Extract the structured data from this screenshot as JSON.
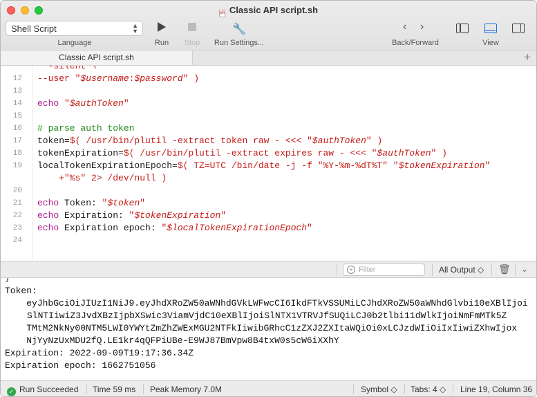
{
  "window": {
    "title": "Classic API script.sh"
  },
  "toolbar": {
    "language_value": "Shell Script",
    "language_label": "Language",
    "run_label": "Run",
    "stop_label": "Stop",
    "run_settings_label": "Run Settings...",
    "back_forward_label": "Back/Forward",
    "view_label": "View",
    "back_glyph": "‹",
    "forward_glyph": "›"
  },
  "tabs": [
    {
      "label": "Classic API script.sh"
    }
  ],
  "tab_add_glyph": "+",
  "editor": {
    "lines": [
      {
        "n": "",
        "parts": [
          {
            "c": "str",
            "t": "  -silent \\"
          }
        ]
      },
      {
        "n": "12",
        "parts": [
          {
            "c": "str",
            "t": "--user \""
          },
          {
            "c": "var",
            "t": "$username"
          },
          {
            "c": "str",
            "t": ":"
          },
          {
            "c": "var",
            "t": "$password"
          },
          {
            "c": "str",
            "t": "\" )"
          }
        ]
      },
      {
        "n": "13",
        "parts": []
      },
      {
        "n": "14",
        "parts": [
          {
            "c": "kw",
            "t": "echo "
          },
          {
            "c": "str",
            "t": "\""
          },
          {
            "c": "var",
            "t": "$authToken"
          },
          {
            "c": "str",
            "t": "\""
          }
        ]
      },
      {
        "n": "15",
        "parts": []
      },
      {
        "n": "16",
        "parts": [
          {
            "c": "cmt",
            "t": "# parse auth token"
          }
        ]
      },
      {
        "n": "17",
        "parts": [
          {
            "c": "plain",
            "t": "token="
          },
          {
            "c": "str",
            "t": "$( /usr/bin/plutil -extract token raw - <<< \""
          },
          {
            "c": "var",
            "t": "$authToken"
          },
          {
            "c": "str",
            "t": "\" )"
          }
        ]
      },
      {
        "n": "18",
        "parts": [
          {
            "c": "plain",
            "t": "tokenExpiration="
          },
          {
            "c": "str",
            "t": "$( /usr/bin/plutil -extract expires raw - <<< \""
          },
          {
            "c": "var",
            "t": "$authToken"
          },
          {
            "c": "str",
            "t": "\" )"
          }
        ]
      },
      {
        "n": "19",
        "parts": [
          {
            "c": "plain",
            "t": "localTokenExpirationEpoch="
          },
          {
            "c": "str",
            "t": "$( TZ=UTC /bin/date -j -f \"%Y-%m-%dT%T\" \""
          },
          {
            "c": "var",
            "t": "$tokenExpiration"
          },
          {
            "c": "str",
            "t": "\""
          }
        ]
      },
      {
        "n": "",
        "parts": [
          {
            "c": "str",
            "t": "    +\"%s\" 2> /dev/null )"
          }
        ]
      },
      {
        "n": "20",
        "parts": []
      },
      {
        "n": "21",
        "parts": [
          {
            "c": "kw",
            "t": "echo "
          },
          {
            "c": "plain",
            "t": "Token: "
          },
          {
            "c": "str",
            "t": "\""
          },
          {
            "c": "var",
            "t": "$token"
          },
          {
            "c": "str",
            "t": "\""
          }
        ]
      },
      {
        "n": "22",
        "parts": [
          {
            "c": "kw",
            "t": "echo "
          },
          {
            "c": "plain",
            "t": "Expiration: "
          },
          {
            "c": "str",
            "t": "\""
          },
          {
            "c": "var",
            "t": "$tokenExpiration"
          },
          {
            "c": "str",
            "t": "\""
          }
        ]
      },
      {
        "n": "23",
        "parts": [
          {
            "c": "kw",
            "t": "echo "
          },
          {
            "c": "plain",
            "t": "Expiration epoch: "
          },
          {
            "c": "str",
            "t": "\""
          },
          {
            "c": "var",
            "t": "$localTokenExpirationEpoch"
          },
          {
            "c": "str",
            "t": "\""
          }
        ]
      },
      {
        "n": "24",
        "parts": []
      }
    ]
  },
  "console_bar": {
    "filter_placeholder": "Filter",
    "output_select": "All Output ◇",
    "trash_glyph": "🗑",
    "collapse_glyph": "⌄"
  },
  "console": {
    "lines": [
      "}",
      "Token:",
      "    eyJhbGciOiJIUzI1NiJ9.eyJhdXRoZW50aWNhdGVkLWFwcCI6IkdFTkVSSUMiLCJhdXRoZW50aWNhdGlvbi10eXBlIjoiSlNTIiwiZ3JvdXBzIjpbXSwic3ViamVjdC10eXBlIjoiSlNTX1VTRVJfSUQiLCJ0b2tlbi11dWlkIjoiNmFmMTk5Z",
      "    TMtM2NkNy00NTM5LWI0YWYtZmZhZWExMGU2NTFkIiwibGRhcC1zZXJ2ZXItaWQiOi0xLCJzdWIiOiIxIiwiZXhwIjox",
      "    NjYyNzUxMDU2fQ.LE1kr4qQFPiUBe-E9WJ87BmVpw8B4txW0s5cW6iXXhY",
      "Expiration: 2022-09-09T19:17:36.34Z",
      "Expiration epoch: 1662751056"
    ]
  },
  "status": {
    "run_status": "Run Succeeded",
    "time": "Time 59 ms",
    "memory": "Peak Memory 7.0M",
    "symbol": "Symbol ◇",
    "tabs": "Tabs: 4 ◇",
    "position": "Line 19, Column 36"
  }
}
